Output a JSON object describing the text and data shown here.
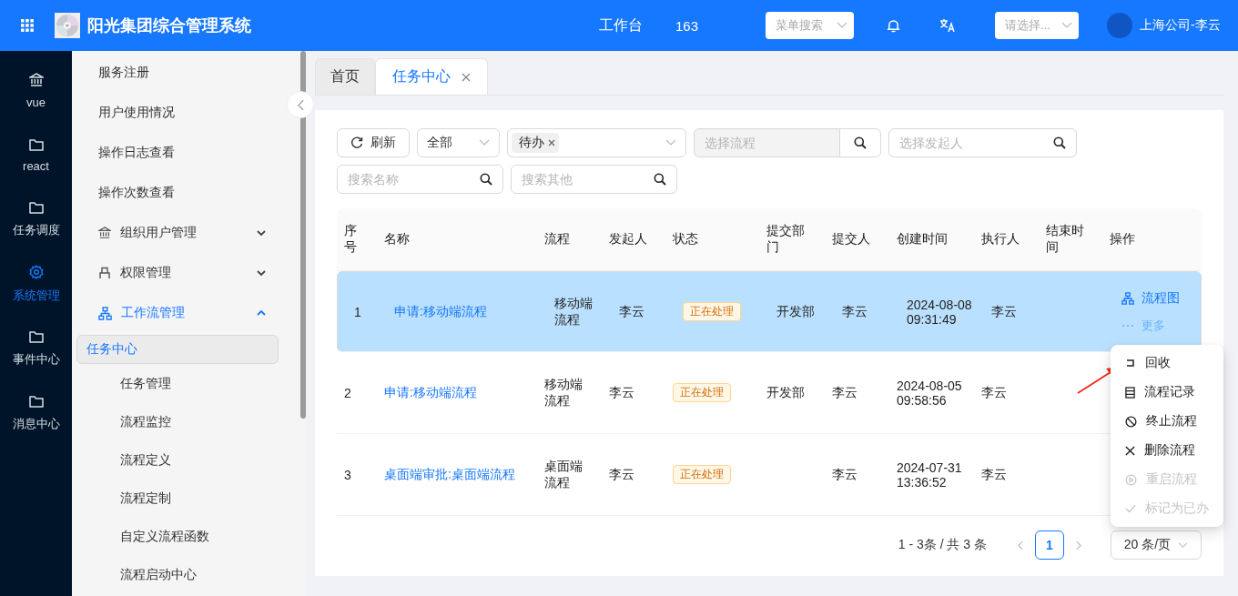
{
  "header": {
    "title": "阳光集团综合管理系统",
    "workbench": "工作台",
    "count": "163",
    "menu_search": {
      "placeholder": "菜单搜索"
    },
    "company_select": {
      "placeholder": "请选择..."
    },
    "user": "上海公司-李云"
  },
  "rail": [
    {
      "label": "vue",
      "selected": false
    },
    {
      "label": "react",
      "selected": false
    },
    {
      "label": "任务调度",
      "selected": false
    },
    {
      "label": "系统管理",
      "selected": true
    },
    {
      "label": "事件中心",
      "selected": false
    },
    {
      "label": "消息中心",
      "selected": false
    }
  ],
  "submenu": [
    {
      "kind": "item",
      "label": "服务注册"
    },
    {
      "kind": "item",
      "label": "用户使用情况"
    },
    {
      "kind": "item",
      "label": "操作日志查看"
    },
    {
      "kind": "item",
      "label": "操作次数查看"
    },
    {
      "kind": "group",
      "label": "组织用户管理",
      "expanded": false,
      "active": false
    },
    {
      "kind": "group",
      "label": "权限管理",
      "expanded": false,
      "active": false
    },
    {
      "kind": "group",
      "label": "工作流管理",
      "expanded": true,
      "active": true,
      "children": [
        {
          "label": "任务中心",
          "selected": true
        },
        {
          "label": "任务管理",
          "selected": false
        },
        {
          "label": "流程监控",
          "selected": false
        },
        {
          "label": "流程定义",
          "selected": false
        },
        {
          "label": "流程定制",
          "selected": false
        },
        {
          "label": "自定义流程函数",
          "selected": false
        },
        {
          "label": "流程启动中心",
          "selected": false
        }
      ]
    }
  ],
  "tabs": [
    {
      "label": "首页",
      "selected": false,
      "closable": false
    },
    {
      "label": "任务中心",
      "selected": true,
      "closable": true
    }
  ],
  "filters": {
    "refresh": "刷新",
    "scope": "全部",
    "status_tags": [
      "待办"
    ],
    "flow": {
      "placeholder": "选择流程",
      "disabled": true
    },
    "initiator": {
      "placeholder": "选择发起人"
    },
    "name_search": {
      "placeholder": "搜索名称"
    },
    "other_search": {
      "placeholder": "搜索其他"
    }
  },
  "table": {
    "columns": [
      "序号",
      "名称",
      "流程",
      "发起人",
      "状态",
      "提交部门",
      "提交人",
      "创建时间",
      "执行人",
      "结束时间",
      "操作"
    ],
    "rows": [
      {
        "selected": true,
        "index": "1",
        "name": "申请:移动端流程",
        "flow": "移动端流程",
        "initiator": "李云",
        "status": "正在处理",
        "dept": "开发部",
        "submitter": "李云",
        "created": "2024-08-08 09:31:49",
        "executor": "李云",
        "actions": [
          "流程图",
          "更多"
        ]
      },
      {
        "selected": false,
        "index": "2",
        "name": "申请:移动端流程",
        "flow": "移动端流程",
        "initiator": "李云",
        "status": "正在处理",
        "dept": "开发部",
        "submitter": "李云",
        "created": "2024-08-05 09:58:56",
        "executor": "李云"
      },
      {
        "selected": false,
        "index": "3",
        "name": "桌面端审批:桌面端流程",
        "flow": "桌面端流程",
        "initiator": "李云",
        "status": "正在处理",
        "submitter": "李云",
        "created": "2024-07-31 13:36:52",
        "executor": "李云"
      }
    ]
  },
  "action_menu": [
    {
      "label": "回收",
      "disabled": false
    },
    {
      "label": "流程记录",
      "disabled": false
    },
    {
      "label": "终止流程",
      "disabled": false
    },
    {
      "label": "删除流程",
      "disabled": false
    },
    {
      "label": "重启流程",
      "disabled": true
    },
    {
      "label": "标记为已办",
      "disabled": true
    }
  ],
  "pagination": {
    "summary": "1 - 3条 / 共 3 条",
    "pages": [
      {
        "label": "1",
        "selected": true
      }
    ],
    "page_size": "20 条/页"
  }
}
